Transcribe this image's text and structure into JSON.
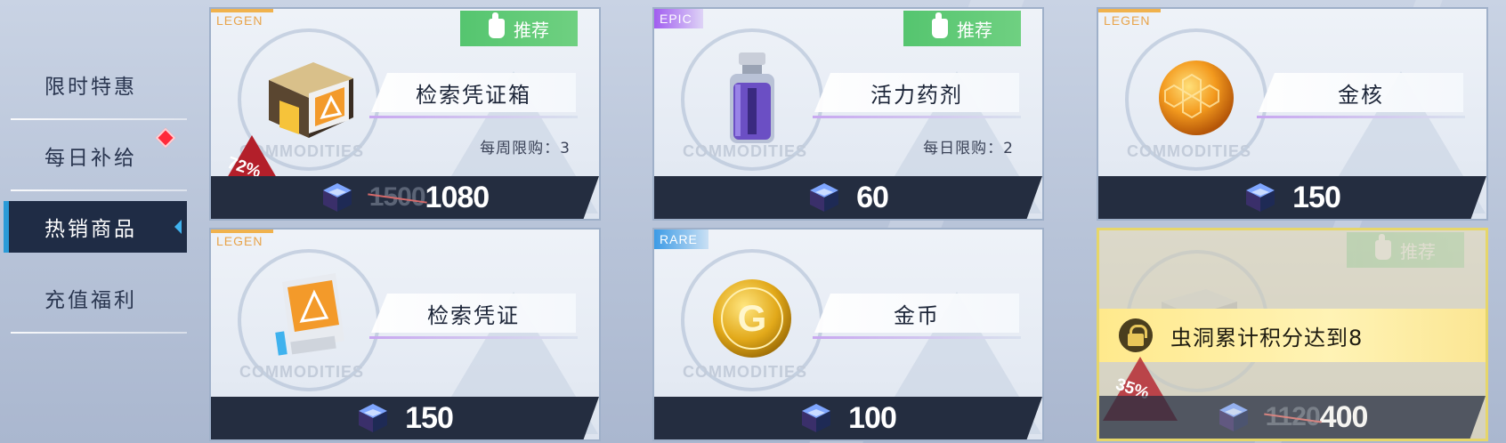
{
  "sidebar": {
    "items": [
      {
        "label": "限时特惠"
      },
      {
        "label": "每日补给"
      },
      {
        "label": "热销商品"
      },
      {
        "label": "充值福利"
      }
    ],
    "active_index": 2
  },
  "cards": [
    {
      "rarity": "LEGEN",
      "recommend": "推荐",
      "name": "检索凭证箱",
      "limit": "每周限购：3",
      "commodities": "COMMODITIES",
      "price_old": "1500",
      "price": "1080",
      "discount": "72%",
      "item_icon": "supply-crate-icon"
    },
    {
      "rarity": "EPIC",
      "recommend": "推荐",
      "name": "活力药剂",
      "limit": "每日限购：2",
      "commodities": "COMMODITIES",
      "price": "60",
      "item_icon": "potion-vial-icon"
    },
    {
      "rarity": "LEGEN",
      "name": "金核",
      "commodities": "COMMODITIES",
      "price": "150",
      "item_icon": "golden-core-icon"
    },
    {
      "rarity": "LEGEN",
      "name": "检索凭证",
      "commodities": "COMMODITIES",
      "price": "150",
      "item_icon": "search-voucher-icon"
    },
    {
      "rarity": "RARE",
      "name": "金币",
      "commodities": "COMMODITIES",
      "price": "100",
      "item_icon": "gold-coin-icon"
    },
    {
      "recommend": "推荐",
      "lock_text": "虫洞累计积分达到8",
      "price_old": "1120",
      "price": "400",
      "discount": "35%",
      "item_icon": "locked-crate-icon"
    }
  ],
  "colors": {
    "legen": "#f0b24d",
    "epic": "#a15df0",
    "rare": "#3c9be6",
    "recommend": "#55c56f",
    "price_bar": "#242d40"
  }
}
